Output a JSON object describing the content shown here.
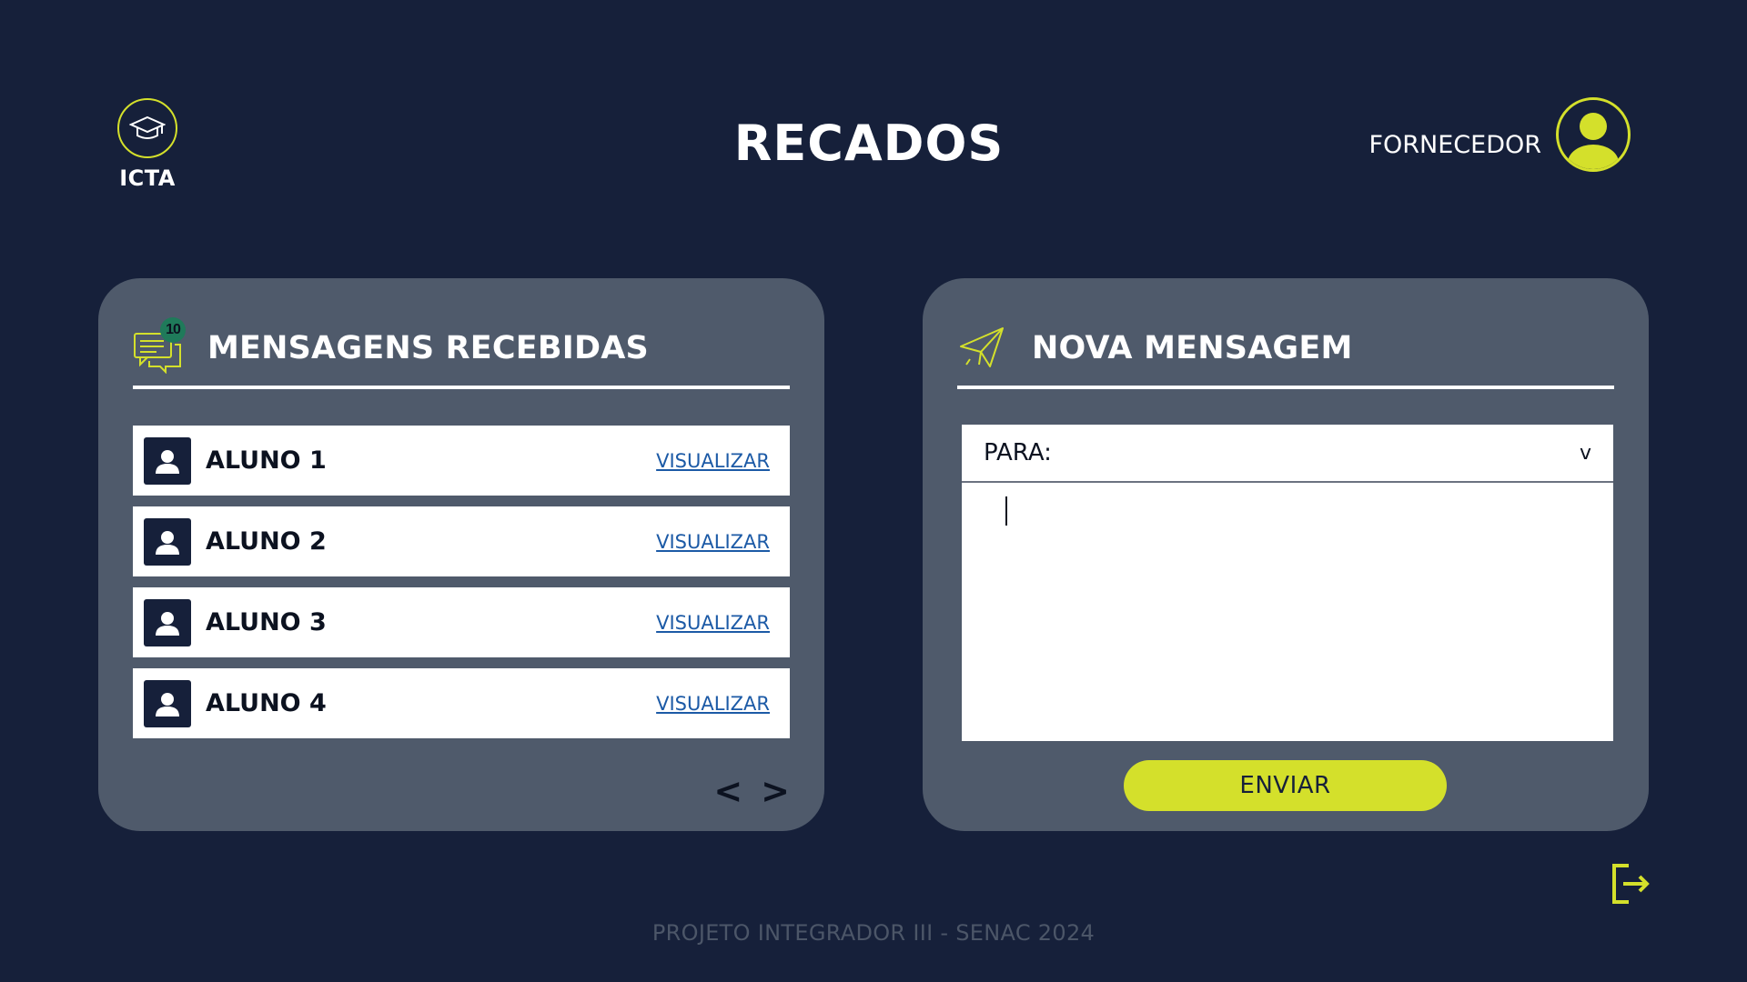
{
  "brand": {
    "name": "ICTA",
    "icon": "graduation-cap-icon"
  },
  "page": {
    "title": "RECADOS"
  },
  "user": {
    "role": "FORNECEDOR",
    "icon": "user-avatar-icon"
  },
  "inbox": {
    "title": "MENSAGENS RECEBIDAS",
    "icon": "chat-bubbles-icon",
    "badge_count": "10",
    "items": [
      {
        "name": "ALUNO 1",
        "action": "VISUALIZAR"
      },
      {
        "name": "ALUNO 2",
        "action": "VISUALIZAR"
      },
      {
        "name": "ALUNO 3",
        "action": "VISUALIZAR"
      },
      {
        "name": "ALUNO 4",
        "action": "VISUALIZAR"
      }
    ],
    "pager": {
      "prev": "<",
      "next": ">"
    }
  },
  "compose": {
    "title": "NOVA MENSAGEM",
    "icon": "paper-plane-icon",
    "to_label": "PARA:",
    "to_chevron": "v",
    "body_value": "",
    "send_label": "ENVIAR"
  },
  "logout": {
    "icon": "logout-icon"
  },
  "footer": {
    "text": "PROJETO INTEGRADOR III - SENAC 2024"
  },
  "colors": {
    "background": "#16203a",
    "panel": "#4f5a6b",
    "accent": "#d4e02b",
    "link": "#1c5aa6"
  }
}
